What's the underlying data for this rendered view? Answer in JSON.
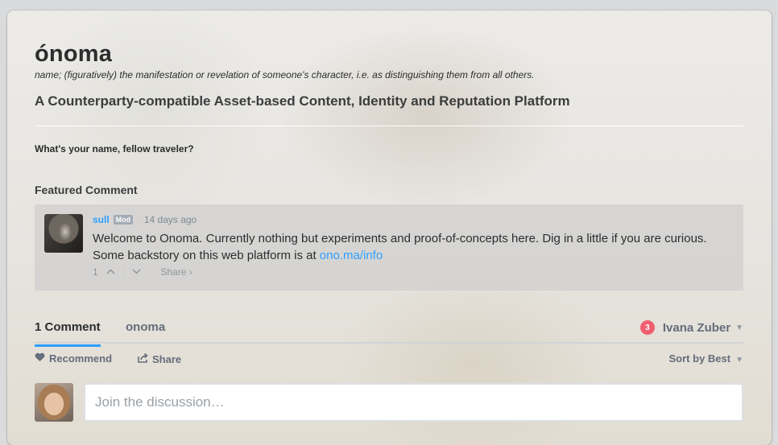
{
  "site": {
    "title": "ónoma",
    "definition": "name; (figuratively) the manifestation or revelation of someone's character, i.e. as distinguishing them from all others.",
    "tagline": "A Counterparty-compatible Asset-based Content, Identity and Reputation Platform",
    "question": "What's your name, fellow traveler?"
  },
  "featured": {
    "heading": "Featured Comment",
    "author": "sull",
    "badge": "Mod",
    "separator": "·",
    "time": "14 days ago",
    "text_before_link": "Welcome to Onoma. Currently nothing but experiments and proof-of-concepts here. Dig in a little if you are curious. Some backstory on this web platform is at ",
    "link_text": "ono.ma/info",
    "votes": "1",
    "upvote_icon": "^",
    "downvote_icon": "v",
    "share_label": "Share ›"
  },
  "tabs": {
    "comments": "1 Comment",
    "site": "onoma"
  },
  "user": {
    "notifications": "3",
    "name": "Ivana Zuber"
  },
  "actions": {
    "recommend": "Recommend",
    "share": "Share",
    "sort": "Sort by Best"
  },
  "composer": {
    "placeholder": "Join the discussion…"
  },
  "icons": {
    "heart": "heart-icon",
    "share": "share-icon",
    "caret": "chevron-down-icon"
  },
  "colors": {
    "accent": "#2e9fff",
    "notification": "#f05f70",
    "text": "#2a2e2e",
    "muted": "#656c7a"
  }
}
